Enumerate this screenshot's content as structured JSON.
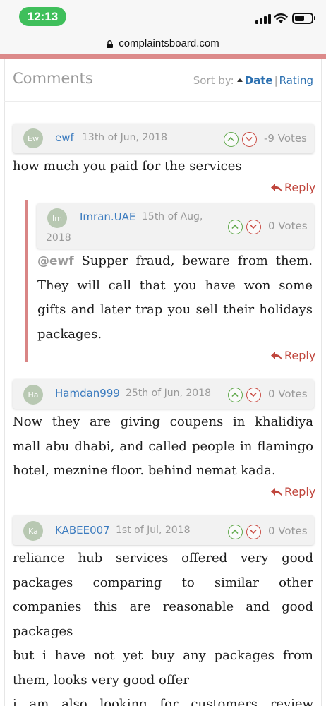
{
  "status_bar": {
    "time": "12:13"
  },
  "url_bar": {
    "domain": "complaintsboard.com"
  },
  "section": {
    "title": "Comments",
    "sort_label": "Sort by:",
    "sort_date": "Date",
    "sort_separator": "|",
    "sort_rating": "Rating"
  },
  "comments": [
    {
      "initials": "Ew",
      "user": "ewf",
      "date": "13th of Jun, 2018",
      "votes": "-9 Votes",
      "lines": [
        "how much you paid for the services"
      ],
      "reply": "Reply"
    },
    {
      "initials": "Im",
      "user": "Imran.UAE",
      "date_line1": "15th of Aug,",
      "date_line2": "2018",
      "votes": "0 Votes",
      "mention": "@ewf",
      "lines": [
        " Supper fraud, beware from them.",
        "They will call that you have won some",
        "gifts and later trap you sell their holidays",
        "packages."
      ],
      "reply": "Reply"
    },
    {
      "initials": "Ha",
      "user": "Hamdan999",
      "date": "25th of Jun, 2018",
      "votes": "0 Votes",
      "lines": [
        "Now they are giving coupens in khalidiya",
        "mall abu dhabi, and called people in flamingo",
        "hotel, meznine floor. behind nemat kada."
      ],
      "reply": "Reply"
    },
    {
      "initials": "Ka",
      "user": "KABEE007",
      "date": "1st of Jul, 2018",
      "votes": "0 Votes",
      "lines": [
        "reliance hub services offered very good",
        "packages comparing to similar other",
        "companies this are reasonable and good",
        "packages",
        "but i have not yet buy any packages from",
        "them, looks very good offer",
        "i am also looking for customers review"
      ]
    }
  ],
  "colors": {
    "accent_bar": "#dc8a8a",
    "link_blue": "#3b7bbf",
    "reply_red": "#c0463d",
    "vote_up": "#5fa84a",
    "vote_down": "#c94a42"
  }
}
